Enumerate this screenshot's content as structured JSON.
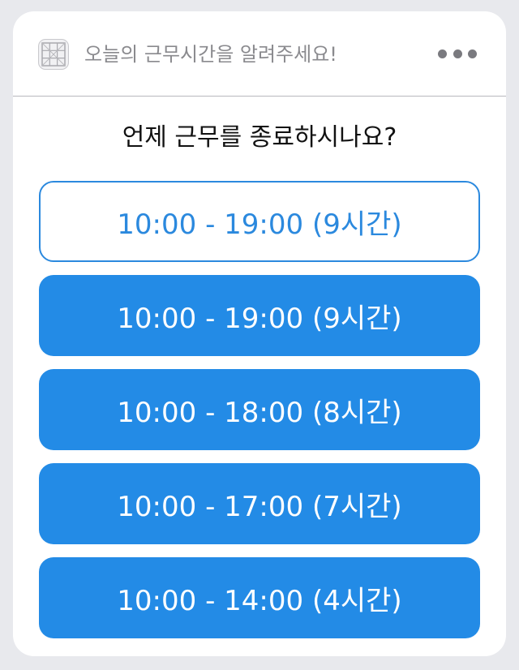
{
  "header": {
    "app_icon": "app-grid-icon",
    "title": "오늘의 근무시간을 알려주세요!",
    "more_icon": "ellipsis-icon"
  },
  "question": "언제 근무를 종료하시나요?",
  "options": [
    {
      "label": "10:00 - 19:00 (9시간)",
      "style": "outline"
    },
    {
      "label": "10:00 - 19:00 (9시간)",
      "style": "filled"
    },
    {
      "label": "10:00 - 18:00 (8시간)",
      "style": "filled"
    },
    {
      "label": "10:00 - 17:00 (7시간)",
      "style": "filled"
    },
    {
      "label": "10:00 - 14:00 (4시간)",
      "style": "filled"
    }
  ],
  "colors": {
    "accent": "#238be6",
    "outline_text": "#2b89de",
    "title_gray": "#8a8a8e",
    "background": "#e8e9ed"
  }
}
